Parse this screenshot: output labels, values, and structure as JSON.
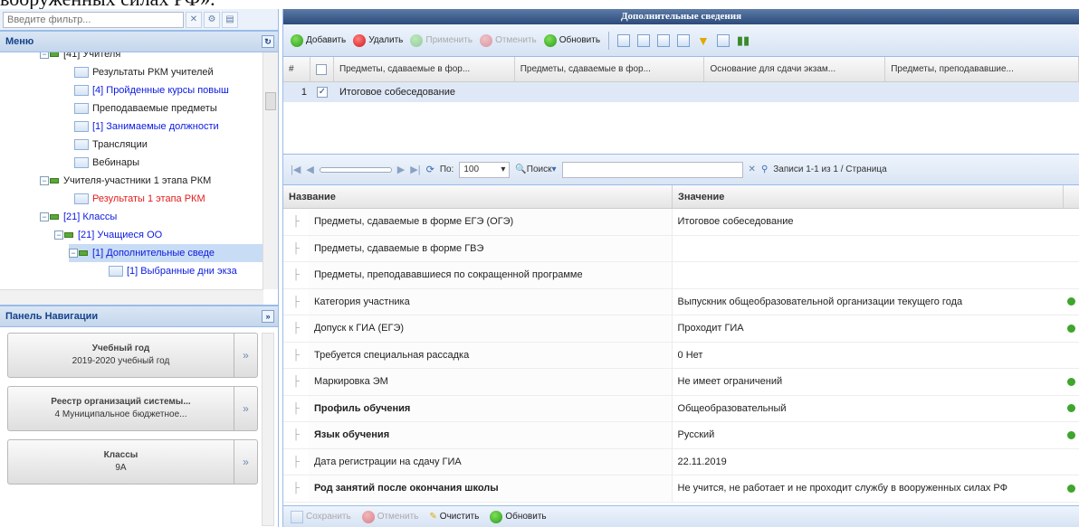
{
  "doc_fragment": "вооруженных силах РФ».",
  "left": {
    "filter_placeholder": "Введите фильтр...",
    "menu_title": "Меню",
    "tree": [
      {
        "label": "[41] Учителя",
        "color": "dark",
        "kind": "folder"
      },
      {
        "label": "Результаты РКМ учителей",
        "color": "dark",
        "kind": "leaf"
      },
      {
        "label": "[4] Пройденные курсы повыш",
        "color": "blue",
        "kind": "leaf"
      },
      {
        "label": "Преподаваемые предметы",
        "color": "dark",
        "kind": "leaf"
      },
      {
        "label": "[1] Занимаемые должности",
        "color": "blue",
        "kind": "leaf"
      },
      {
        "label": "Трансляции",
        "color": "dark",
        "kind": "leaf"
      },
      {
        "label": "Вебинары",
        "color": "dark",
        "kind": "leaf"
      },
      {
        "label": "Учителя-участники 1 этапа РКМ",
        "color": "dark",
        "kind": "folder"
      },
      {
        "label": "Результаты 1 этапа РКМ",
        "color": "red",
        "kind": "leaf"
      },
      {
        "label": "[21] Классы",
        "color": "blue",
        "kind": "folder"
      },
      {
        "label": "[21] Учащиеся ОО",
        "color": "blue",
        "kind": "folder"
      },
      {
        "label": "[1] Дополнительные сведе",
        "color": "blue",
        "kind": "folder"
      },
      {
        "label": "[1] Выбранные дни экза",
        "color": "blue",
        "kind": "leaf"
      }
    ],
    "nav_title": "Панель Навигации",
    "nav_items": [
      {
        "title": "Учебный год",
        "value": "2019-2020 учебный год"
      },
      {
        "title": "Реестр организаций системы...",
        "value": "4 Муниципальное бюджетное..."
      },
      {
        "title": "Классы",
        "value": "9А"
      }
    ]
  },
  "right": {
    "title": "Дополнительные сведения",
    "toolbar": {
      "add": "Добавить",
      "delete": "Удалить",
      "apply": "Применить",
      "cancel": "Отменить",
      "refresh": "Обновить"
    },
    "grid": {
      "headers": [
        "#",
        "",
        "Предметы, сдаваемые в фор...",
        "Предметы, сдаваемые в фор...",
        "Основание для сдачи экзам...",
        "Предметы, преподававшие..."
      ],
      "row": {
        "num": "1",
        "value": "Итоговое собеседование"
      }
    },
    "pager": {
      "per_page_label": "По:",
      "per_page": "100",
      "search": "Поиск",
      "records": "Записи 1-1 из 1 / Страница"
    },
    "props": {
      "col_name": "Название",
      "col_value": "Значение",
      "rows": [
        {
          "name": "Предметы, сдаваемые в форме ЕГЭ (ОГЭ)",
          "value": "Итоговое собеседование",
          "bold": false,
          "icon": false
        },
        {
          "name": "Предметы, сдаваемые в форме ГВЭ",
          "value": "",
          "bold": false,
          "icon": false
        },
        {
          "name": "Предметы, преподававшиеся по сокращенной программе",
          "value": "",
          "bold": false,
          "icon": false
        },
        {
          "name": "Категория участника",
          "value": "Выпускник общеобразовательной организации текущего года",
          "bold": false,
          "icon": true
        },
        {
          "name": "Допуск к ГИА (ЕГЭ)",
          "value": "Проходит ГИА",
          "bold": false,
          "icon": true
        },
        {
          "name": "Требуется специальная рассадка",
          "value": "0 Нет",
          "bold": false,
          "icon": false
        },
        {
          "name": "Маркировка ЭМ",
          "value": "Не имеет ограничений",
          "bold": false,
          "icon": true
        },
        {
          "name": "Профиль обучения",
          "value": "Общеобразовательный",
          "bold": true,
          "icon": true
        },
        {
          "name": "Язык обучения",
          "value": "Русский",
          "bold": true,
          "icon": true
        },
        {
          "name": "Дата регистрации на сдачу ГИА",
          "value": "22.11.2019",
          "bold": false,
          "icon": false
        },
        {
          "name": "Род занятий после окончания школы",
          "value": "Не учится, не работает и не проходит службу в вооруженных силах РФ",
          "bold": true,
          "icon": true
        }
      ]
    },
    "bottom": {
      "save": "Сохранить",
      "cancel": "Отменить",
      "clear": "Очистить",
      "refresh": "Обновить"
    }
  }
}
